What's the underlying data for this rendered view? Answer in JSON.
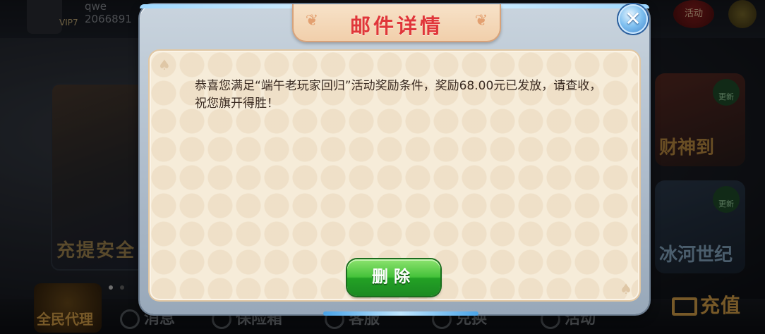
{
  "background": {
    "user_name": "qwe",
    "user_id": "2066891",
    "vip_level": "7",
    "top_buttons": [
      "活动"
    ],
    "left_card_caption": "充提安全",
    "games": [
      {
        "name": "财神到",
        "tag": "更新"
      },
      {
        "name": "冰河世纪",
        "tag": "更新"
      }
    ],
    "bottom_bar": {
      "agent": "全民代理",
      "items": [
        "消息",
        "保险箱",
        "客服",
        "兑换",
        "活动"
      ],
      "recharge": "充值"
    }
  },
  "dialog": {
    "title": "邮件详情",
    "close_symbol": "✕",
    "message": "恭喜您满足“端午老玩家回归”活动奖励条件，奖励68.00元已发放，请查收，祝您旗开得胜！",
    "delete_label": "删除"
  }
}
